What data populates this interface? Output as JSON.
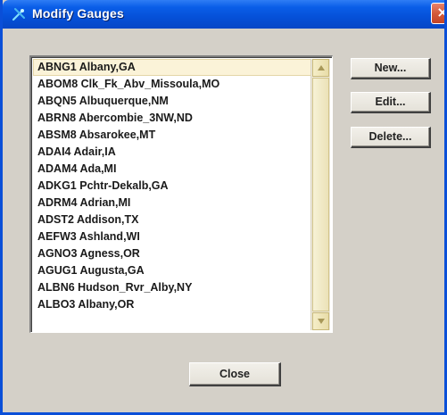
{
  "window": {
    "title": "Modify Gauges",
    "close_glyph": "×",
    "icon": "app-wand-icon"
  },
  "gauges": {
    "selected_index": 0,
    "items": [
      "ABNG1 Albany,GA",
      "ABOM8 Clk_Fk_Abv_Missoula,MO",
      "ABQN5 Albuquerque,NM",
      "ABRN8 Abercombie_3NW,ND",
      "ABSM8 Absarokee,MT",
      "ADAI4 Adair,IA",
      "ADAM4 Ada,MI",
      "ADKG1 Pchtr-Dekalb,GA",
      "ADRM4 Adrian,MI",
      "ADST2 Addison,TX",
      "AEFW3 Ashland,WI",
      "AGNO3 Agness,OR",
      "AGUG1 Augusta,GA",
      "ALBN6 Hudson_Rvr_Alby,NY",
      "ALBO3 Albany,OR"
    ]
  },
  "buttons": {
    "new_label": "New...",
    "edit_label": "Edit...",
    "delete_label": "Delete...",
    "close_label": "Close"
  },
  "colors": {
    "title_bar": "#0550d8",
    "dialog_bg": "#d4d0c8",
    "selection_bg": "#fbf3d8",
    "close_x_bg": "#d45a3a"
  }
}
